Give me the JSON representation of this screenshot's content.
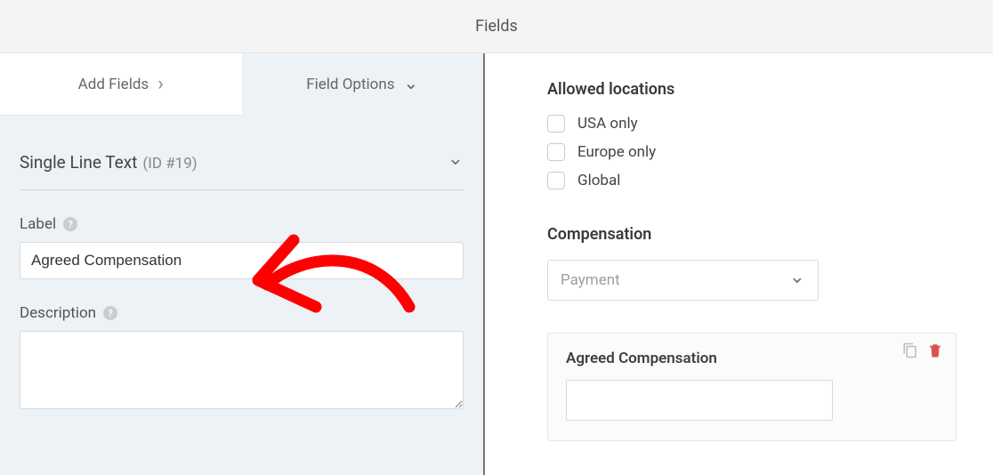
{
  "header": {
    "title": "Fields"
  },
  "tabs": {
    "add_fields": "Add Fields",
    "field_options": "Field Options"
  },
  "field_type": {
    "name": "Single Line Text",
    "id_text": "(ID #19)"
  },
  "labels": {
    "label": "Label",
    "description": "Description"
  },
  "inputs": {
    "label_value": "Agreed Compensation",
    "description_value": ""
  },
  "preview": {
    "allowed_locations_heading": "Allowed locations",
    "locations": [
      "USA only",
      "Europe only",
      "Global"
    ],
    "compensation_heading": "Compensation",
    "compensation_placeholder": "Payment",
    "agreed_comp_label": "Agreed Compensation"
  }
}
